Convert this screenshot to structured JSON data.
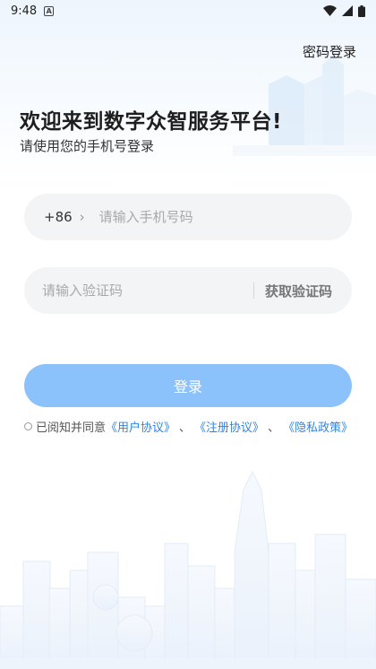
{
  "status_bar": {
    "time": "9:48",
    "notification_icon": "A"
  },
  "header": {
    "password_login": "密码登录"
  },
  "welcome": {
    "title": "欢迎来到数字众智服务平台!",
    "subtitle": "请使用您的手机号登录"
  },
  "phone": {
    "country_code": "+86",
    "chevron": "›",
    "placeholder": "请输入手机号码"
  },
  "code": {
    "placeholder": "请输入验证码",
    "get_code": "获取验证码"
  },
  "login": {
    "label": "登录"
  },
  "agreement": {
    "prefix": "已阅知并同意",
    "user_agreement": "《用户协议》",
    "separator1": "、",
    "register_agreement": "《注册协议》",
    "separator2": "、",
    "privacy_policy": "《隐私政策》"
  },
  "colors": {
    "accent": "#2f84e6",
    "button": "#8cc2fb",
    "field_bg": "#f3f4f6"
  }
}
